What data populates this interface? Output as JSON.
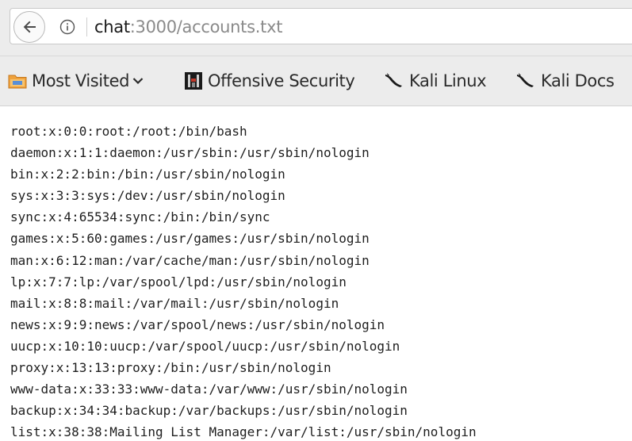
{
  "address_bar": {
    "url_host": "chat",
    "url_rest": ":3000/accounts.txt"
  },
  "bookmarks": {
    "most_visited": "Most Visited",
    "offensive_security": "Offensive Security",
    "kali_linux": "Kali Linux",
    "kali_docs": "Kali Docs"
  },
  "file_lines": [
    "root:x:0:0:root:/root:/bin/bash",
    "daemon:x:1:1:daemon:/usr/sbin:/usr/sbin/nologin",
    "bin:x:2:2:bin:/bin:/usr/sbin/nologin",
    "sys:x:3:3:sys:/dev:/usr/sbin/nologin",
    "sync:x:4:65534:sync:/bin:/bin/sync",
    "games:x:5:60:games:/usr/games:/usr/sbin/nologin",
    "man:x:6:12:man:/var/cache/man:/usr/sbin/nologin",
    "lp:x:7:7:lp:/var/spool/lpd:/usr/sbin/nologin",
    "mail:x:8:8:mail:/var/mail:/usr/sbin/nologin",
    "news:x:9:9:news:/var/spool/news:/usr/sbin/nologin",
    "uucp:x:10:10:uucp:/var/spool/uucp:/usr/sbin/nologin",
    "proxy:x:13:13:proxy:/bin:/usr/sbin/nologin",
    "www-data:x:33:33:www-data:/var/www:/usr/sbin/nologin",
    "backup:x:34:34:backup:/var/backups:/usr/sbin/nologin",
    "list:x:38:38:Mailing List Manager:/var/list:/usr/sbin/nologin"
  ],
  "icons": {
    "back": "back-arrow-icon",
    "info": "info-icon",
    "most_visited": "folder-icon",
    "offensive_security": "offensive-security-logo-icon",
    "kali_linux": "kali-dragon-icon",
    "kali_docs": "kali-dragon-icon"
  },
  "colors": {
    "toolbar_bg": "#ececec",
    "url_host": "#1a1a1a",
    "url_rest": "#8a8a8a",
    "text": "#1e1e1e",
    "folder_orange": "#e8922a"
  }
}
